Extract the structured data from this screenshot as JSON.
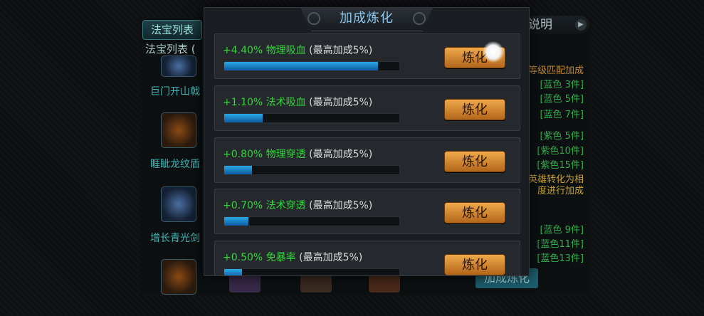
{
  "background": {
    "tab_label": "法宝列表",
    "subtitle": "法宝列表 (",
    "items": [
      {
        "name": "巨门开山戟"
      },
      {
        "name": "睚眦龙纹盾"
      },
      {
        "name": "增长青光剑"
      }
    ],
    "right_title": "说明",
    "right_header": "等级匹配加成",
    "right_lines": [
      {
        "text": "[蓝色 3件]",
        "color": "#2fb04a"
      },
      {
        "text": "[蓝色 5件]",
        "color": "#2fb04a"
      },
      {
        "text": "[蓝色 7件]",
        "color": "#2fb04a"
      },
      {
        "text": "[紫色 5件]",
        "color": "#2fb04a"
      },
      {
        "text": "[紫色10件]",
        "color": "#2fb04a"
      },
      {
        "text": "[紫色15件]",
        "color": "#2fb04a"
      },
      {
        "text": "英雄转化为相",
        "color": "#c7a233"
      },
      {
        "text": "度进行加成",
        "color": "#c7a233"
      },
      {
        "text": "[蓝色 9件]",
        "color": "#2fb04a"
      },
      {
        "text": "[蓝色11件]",
        "color": "#2fb04a"
      },
      {
        "text": "[蓝色13件]",
        "color": "#2fb04a"
      }
    ],
    "bottom_button": "加成炼化"
  },
  "dialog": {
    "title": "加成炼化",
    "rows": [
      {
        "value": "+4.40%",
        "name": "物理吸血",
        "note": "(最高加成5%)",
        "progress": 0.88,
        "button": "炼化"
      },
      {
        "value": "+1.10%",
        "name": "法术吸血",
        "note": "(最高加成5%)",
        "progress": 0.22,
        "button": "炼化"
      },
      {
        "value": "+0.80%",
        "name": "物理穿透",
        "note": "(最高加成5%)",
        "progress": 0.16,
        "button": "炼化"
      },
      {
        "value": "+0.70%",
        "name": "法术穿透",
        "note": "(最高加成5%)",
        "progress": 0.14,
        "button": "炼化"
      },
      {
        "value": "+0.50%",
        "name": "免暴率",
        "note": "(最高加成5%)",
        "progress": 0.1,
        "button": "炼化"
      }
    ]
  }
}
